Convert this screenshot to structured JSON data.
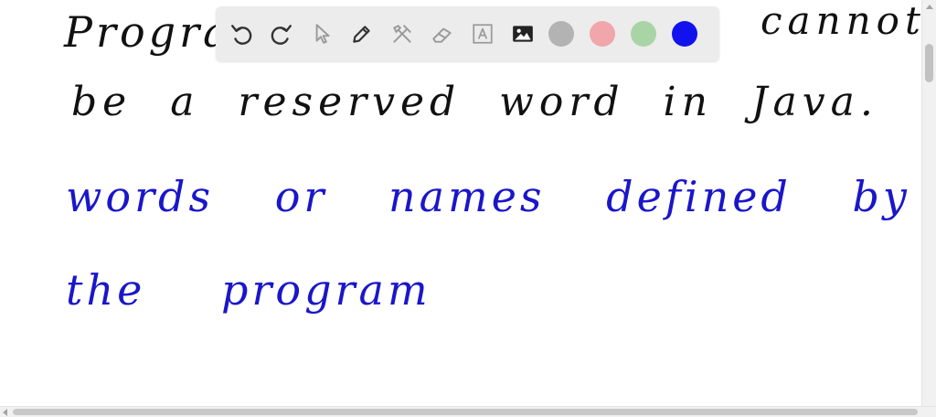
{
  "canvas": {
    "lines": [
      {
        "text": "Progra",
        "color": "#111111"
      },
      {
        "text": "cannot",
        "color": "#111111"
      },
      {
        "text": "be a reserved word in Java.",
        "color": "#111111"
      },
      {
        "text": "words or names defined by",
        "color": "#1a16c9"
      },
      {
        "text": "the program",
        "color": "#1a16c9"
      }
    ]
  },
  "toolbar": {
    "tools": [
      {
        "name": "undo",
        "icon": "undo-icon",
        "enabled": true
      },
      {
        "name": "redo",
        "icon": "redo-icon",
        "enabled": true
      },
      {
        "name": "select",
        "icon": "pointer-icon",
        "enabled": false
      },
      {
        "name": "pen",
        "icon": "pen-icon",
        "enabled": true
      },
      {
        "name": "tools",
        "icon": "wrench-hammer-icon",
        "enabled": false
      },
      {
        "name": "eraser",
        "icon": "eraser-icon",
        "enabled": false
      },
      {
        "name": "text",
        "icon": "text-box-icon",
        "enabled": false
      },
      {
        "name": "image",
        "icon": "image-icon",
        "enabled": true
      }
    ],
    "colors": [
      {
        "name": "gray",
        "hex": "#b3b3b3"
      },
      {
        "name": "pink",
        "hex": "#f0a6ab"
      },
      {
        "name": "green",
        "hex": "#a9d4a6"
      },
      {
        "name": "blue",
        "hex": "#1212ee",
        "selected": true
      }
    ]
  }
}
